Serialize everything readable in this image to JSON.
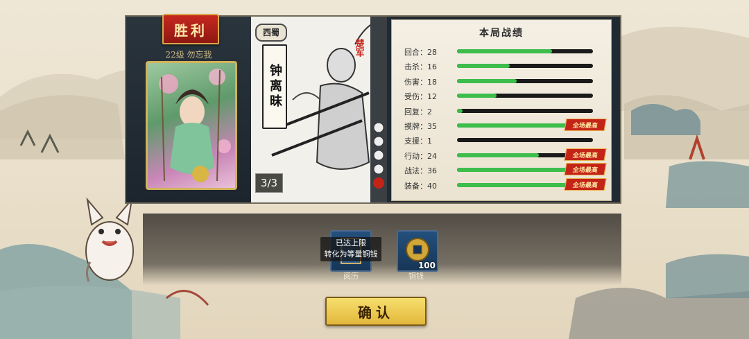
{
  "header": {
    "victory_label": "胜利",
    "player_level_name": "22级 勿忘我"
  },
  "general": {
    "faction": "西蜀",
    "name": "钟离昧",
    "side": "楚军",
    "count": "3/3"
  },
  "stats": {
    "title": "本局战绩",
    "mvp_label": "全场最高",
    "rows": [
      {
        "label": "回合：28",
        "fill": 0.7,
        "mvp": false
      },
      {
        "label": "击杀：16",
        "fill": 0.39,
        "mvp": false
      },
      {
        "label": "伤害：18",
        "fill": 0.44,
        "mvp": false
      },
      {
        "label": "受伤：12",
        "fill": 0.29,
        "mvp": false
      },
      {
        "label": "回复：2",
        "fill": 0.04,
        "mvp": false
      },
      {
        "label": "摸牌：35",
        "fill": 0.88,
        "mvp": true
      },
      {
        "label": "支援：1",
        "fill": 0.0,
        "mvp": false
      },
      {
        "label": "行动：24",
        "fill": 0.6,
        "mvp": true
      },
      {
        "label": "战法：36",
        "fill": 0.9,
        "mvp": true
      },
      {
        "label": "装备：40",
        "fill": 1.0,
        "mvp": true
      }
    ]
  },
  "rewards": {
    "experience": {
      "label": "阅历",
      "tip_line1": "已达上限",
      "tip_line2": "转化为等量铜钱"
    },
    "coins": {
      "label": "铜钱",
      "amount": "100"
    }
  },
  "buttons": {
    "confirm": "确认"
  },
  "colors": {
    "bar_fill": "#3dbd4c",
    "victory_red": "#c6281f",
    "button_gold": "#e2b73b"
  }
}
